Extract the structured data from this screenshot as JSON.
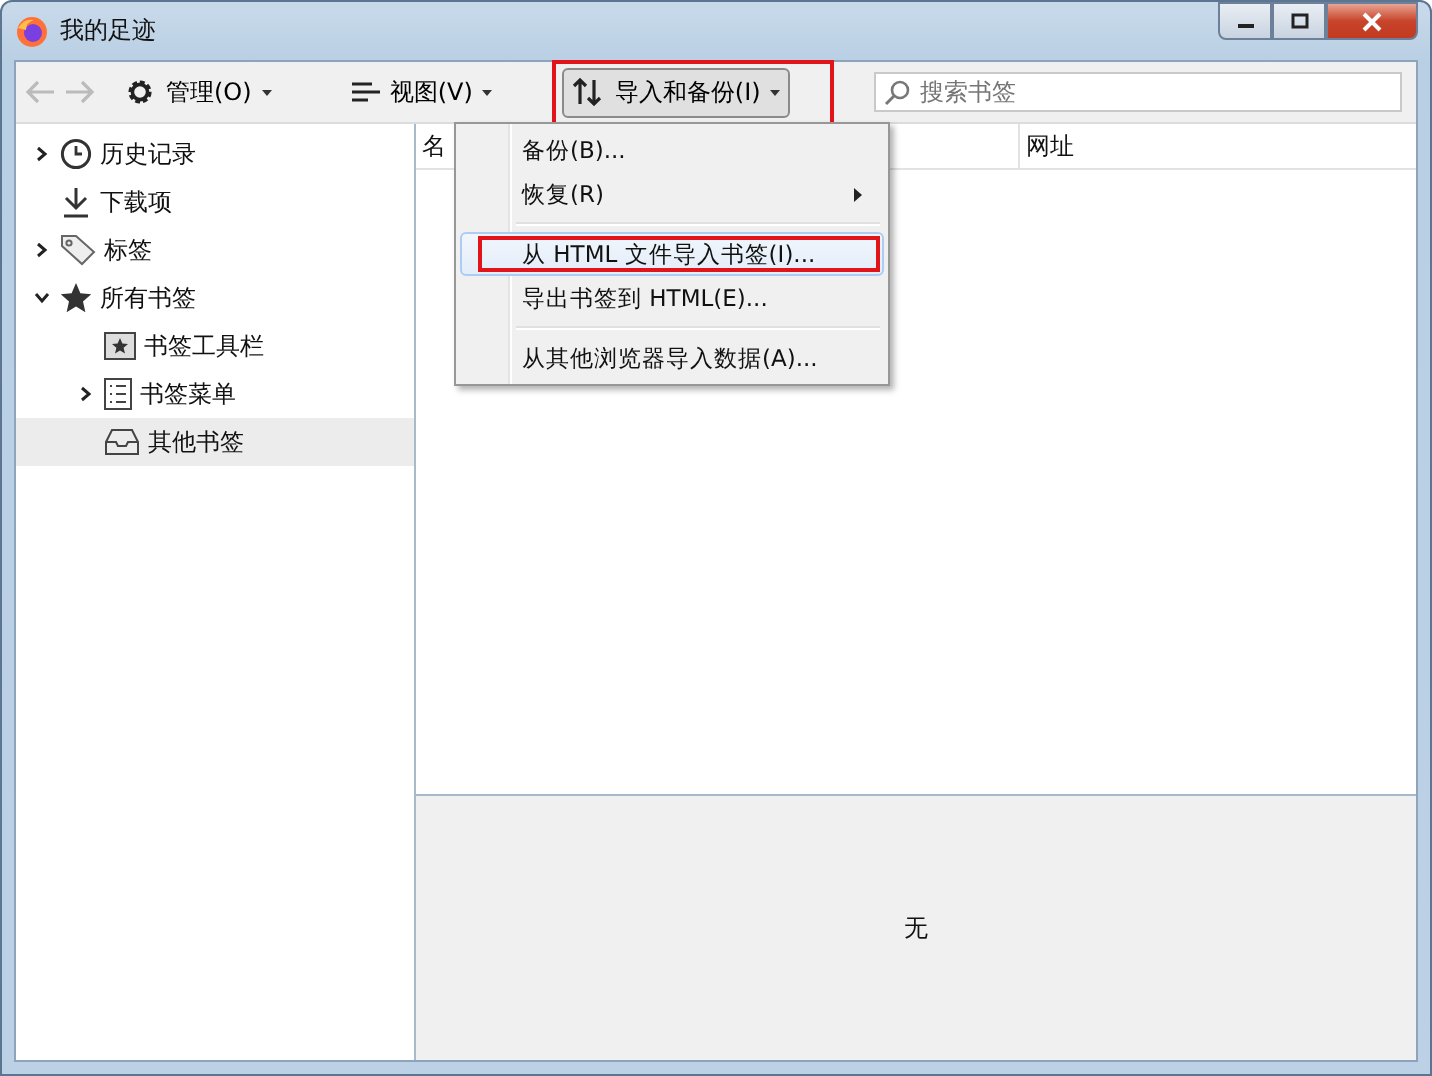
{
  "window": {
    "title": "我的足迹"
  },
  "toolbar": {
    "items": [
      {
        "label": "管理(O)",
        "pressed": false,
        "annotated": false
      },
      {
        "label": "视图(V)",
        "pressed": false,
        "annotated": false
      },
      {
        "label": "导入和备份(I)",
        "pressed": true,
        "annotated": true
      }
    ],
    "search": {
      "placeholder": "搜索书签"
    }
  },
  "sidebar": {
    "items": [
      {
        "label": "历史记录",
        "expanded": false,
        "selected": false
      },
      {
        "label": "下载项",
        "selected": false
      },
      {
        "label": "标签",
        "expanded": false,
        "selected": false
      },
      {
        "label": "所有书签",
        "expanded": true,
        "selected": false,
        "children": [
          {
            "label": "书签工具栏",
            "selected": false
          },
          {
            "label": "书签菜单",
            "expanded": false,
            "selected": false
          },
          {
            "label": "其他书签",
            "selected": true
          }
        ]
      }
    ]
  },
  "table": {
    "columns": [
      "名",
      "网址"
    ]
  },
  "details": {
    "text": "无"
  },
  "menu": {
    "items": [
      {
        "kind": "item",
        "label": "备份(B)...",
        "submenu": false,
        "selected": false,
        "annotated": false
      },
      {
        "kind": "item",
        "label": "恢复(R)",
        "submenu": true,
        "selected": false,
        "annotated": false
      },
      {
        "kind": "separator"
      },
      {
        "kind": "item",
        "label": "从 HTML 文件导入书签(I)...",
        "submenu": false,
        "selected": true,
        "annotated": true
      },
      {
        "kind": "item",
        "label": "导出书签到 HTML(E)...",
        "submenu": false,
        "selected": false,
        "annotated": false
      },
      {
        "kind": "separator"
      },
      {
        "kind": "item",
        "label": "从其他浏览器导入数据(A)...",
        "submenu": false,
        "selected": false,
        "annotated": false
      }
    ]
  }
}
